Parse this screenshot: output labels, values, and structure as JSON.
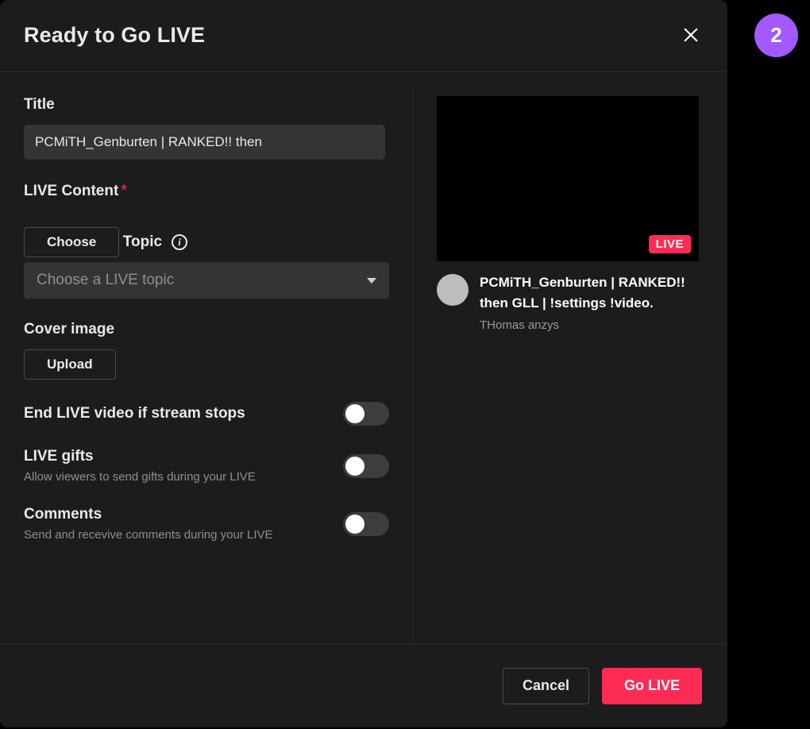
{
  "annotation": {
    "step_number": "2"
  },
  "header": {
    "title": "Ready to Go LIVE"
  },
  "form": {
    "title": {
      "label": "Title",
      "value": "PCMiTH_Genburten | RANKED!! then"
    },
    "live_content": {
      "label": "LIVE Content",
      "required_mark": "*",
      "choose_button": "Choose"
    },
    "topic": {
      "label": "Topic",
      "placeholder": "Choose a LIVE topic"
    },
    "cover_image": {
      "label": "Cover image",
      "upload_button": "Upload"
    },
    "end_stream_toggle": {
      "label": "End LIVE video if stream stops"
    },
    "gifts_toggle": {
      "label": "LIVE gifts",
      "subtitle": "Allow viewers to send gifts during your LIVE"
    },
    "comments_toggle": {
      "label": "Comments",
      "subtitle": "Send and recevive comments during your LIVE"
    }
  },
  "preview": {
    "live_badge": "LIVE",
    "title": "PCMiTH_Genburten | RANKED!! then GLL | !settings !video.",
    "user": "THomas anzys"
  },
  "footer": {
    "cancel": "Cancel",
    "go_live": "Go LIVE"
  }
}
